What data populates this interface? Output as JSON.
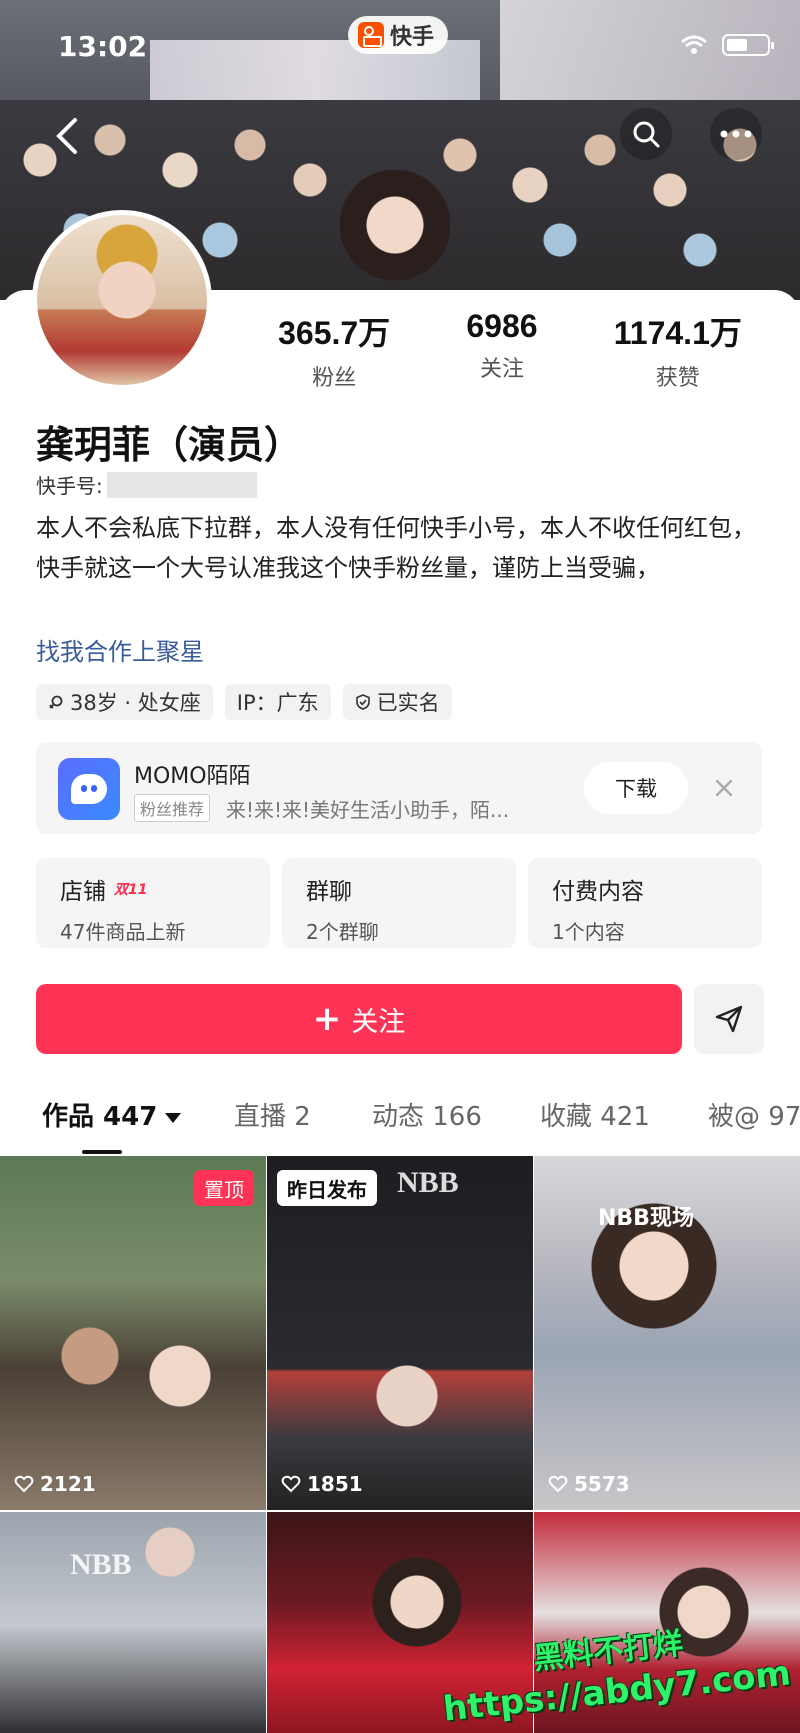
{
  "status": {
    "time": "13:02"
  },
  "brand": {
    "name": "快手"
  },
  "profile": {
    "name": "龚玥菲（演员）",
    "kuaishou_id_label": "快手号:",
    "bio": "本人不会私底下拉群，本人没有任何快手小号，本人不收任何红包，快手就这一个大号认准我这个快手粉丝量，谨防上当受骗，",
    "collab_link": "找我合作上聚星",
    "tags": [
      "38岁 · 处女座",
      "IP：广东",
      "已实名"
    ]
  },
  "stats": [
    {
      "value": "365.7万",
      "label": "粉丝"
    },
    {
      "value": "6986",
      "label": "关注"
    },
    {
      "value": "1174.1万",
      "label": "获赞"
    }
  ],
  "ad": {
    "title": "MOMO陌陌",
    "badge": "粉丝推荐",
    "desc": "来!来!来!美好生活小助手，陌...",
    "button": "下载"
  },
  "entries": [
    {
      "title": "店铺",
      "hot": "双11",
      "sub": "47件商品上新"
    },
    {
      "title": "群聊",
      "hot": "",
      "sub": "2个群聊"
    },
    {
      "title": "付费内容",
      "hot": "",
      "sub": "1个内容"
    }
  ],
  "actions": {
    "follow": "关注"
  },
  "tabs": [
    "作品 447",
    "直播 2",
    "动态 166",
    "收藏 421",
    "被@ 97"
  ],
  "videos": [
    {
      "badge": "置顶",
      "logo": "",
      "tag": "",
      "likes": "2121"
    },
    {
      "badge": "昨日发布",
      "logo": "NBB",
      "tag": "",
      "likes": "1851"
    },
    {
      "badge": "",
      "logo": "",
      "tag": "NBB现场",
      "likes": "5573"
    },
    {
      "badge": "",
      "logo": "NBB",
      "tag": "",
      "likes": ""
    },
    {
      "badge": "",
      "logo": "",
      "tag": "",
      "likes": ""
    },
    {
      "badge": "",
      "logo": "",
      "tag": "",
      "likes": ""
    }
  ],
  "watermark": {
    "line1": "黑料不打烊",
    "line2": "https://abdy7.com"
  },
  "colors": {
    "accent": "#fe3355",
    "link": "#3b5c9a"
  },
  "icons": [
    "back-icon",
    "search-icon",
    "more-icon",
    "close-icon",
    "send-icon",
    "heart-icon",
    "verified-icon",
    "location-icon"
  ]
}
